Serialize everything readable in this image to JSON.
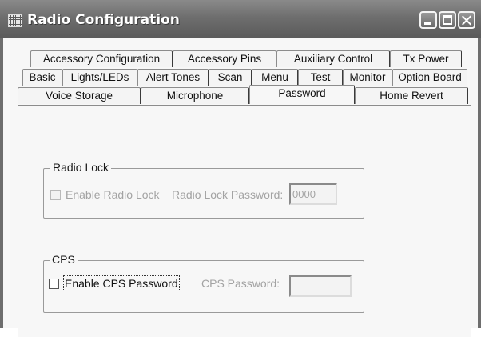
{
  "window": {
    "title": "Radio Configuration"
  },
  "tabs": {
    "row1": [
      "Accessory Configuration",
      "Accessory Pins",
      "Auxiliary Control",
      "Tx Power"
    ],
    "row2": [
      "Basic",
      "Lights/LEDs",
      "Alert Tones",
      "Scan",
      "Menu",
      "Test",
      "Monitor",
      "Option Board"
    ],
    "row3": [
      "Voice Storage",
      "Microphone",
      "Password",
      "Home Revert"
    ],
    "selected": "Password"
  },
  "radio_lock": {
    "group_label": "Radio Lock",
    "enable_label": "Enable Radio Lock",
    "enable_checked": false,
    "enabled": false,
    "password_label": "Radio Lock Password:",
    "password_value": "0000"
  },
  "cps": {
    "group_label": "CPS",
    "enable_label": "Enable CPS Password",
    "enable_checked": false,
    "password_label": "CPS Password:",
    "password_value": ""
  }
}
